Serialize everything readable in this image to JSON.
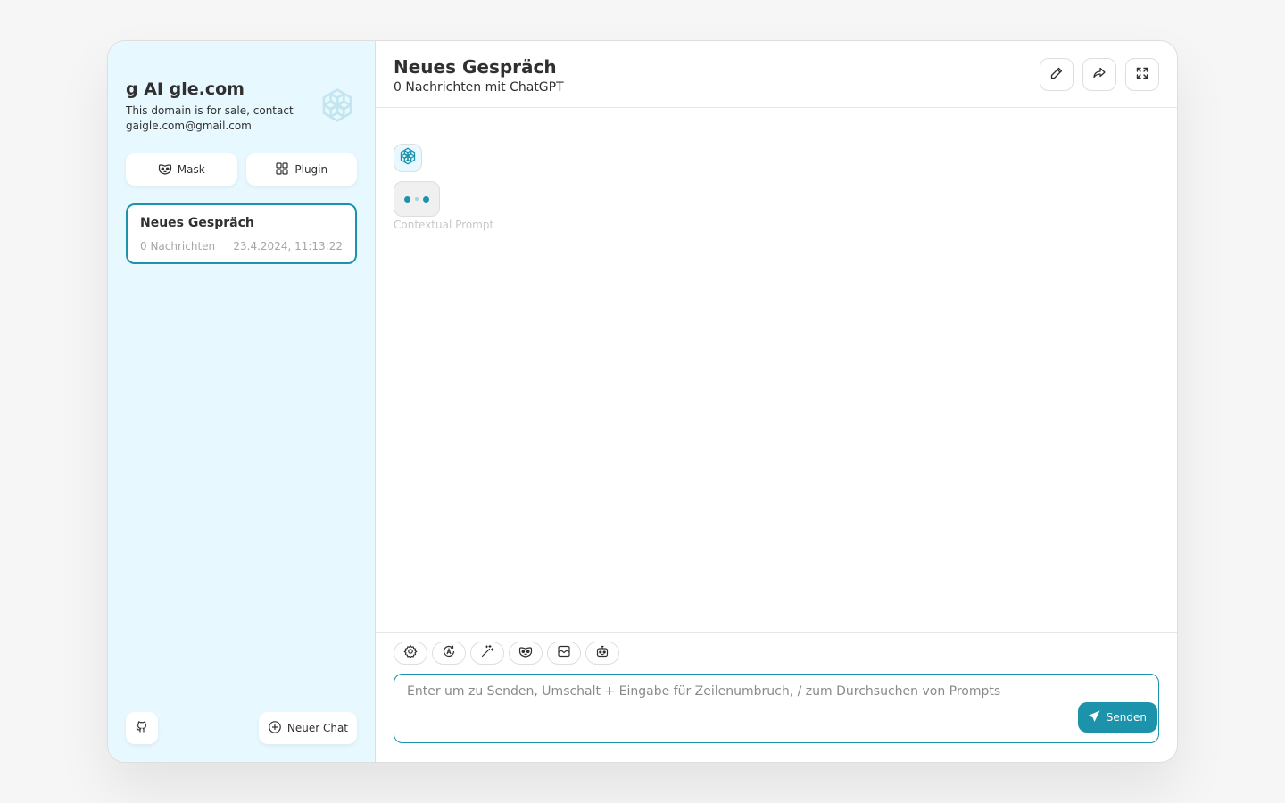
{
  "sidebar": {
    "title": "g AI gle.com",
    "subtitle": "This domain is for sale, contact gaigle.com@gmail.com",
    "mask_label": "Mask",
    "plugin_label": "Plugin",
    "chats": [
      {
        "title": "Neues Gespräch",
        "count": "0 Nachrichten",
        "date": "23.4.2024, 11:13:22"
      }
    ],
    "new_chat_label": "Neuer Chat"
  },
  "header": {
    "title": "Neues Gespräch",
    "subtitle": "0 Nachrichten mit ChatGPT"
  },
  "messages": {
    "contextual_label": "Contextual Prompt"
  },
  "composer": {
    "placeholder": "Enter um zu Senden, Umschalt + Eingabe für Zeilenumbruch, / zum Durchsuchen von Prompts",
    "send_label": "Senden"
  },
  "colors": {
    "accent": "#1d93ab",
    "sidebar_bg": "#e7f8ff"
  },
  "icons": {
    "logo": "openai-logo-icon",
    "mask": "mask-icon",
    "plugin": "plugin-icon",
    "github": "github-icon",
    "new_chat": "add-icon",
    "rename": "edit-icon",
    "share": "share-icon",
    "fullscreen": "maximize-icon",
    "send": "send-icon"
  }
}
